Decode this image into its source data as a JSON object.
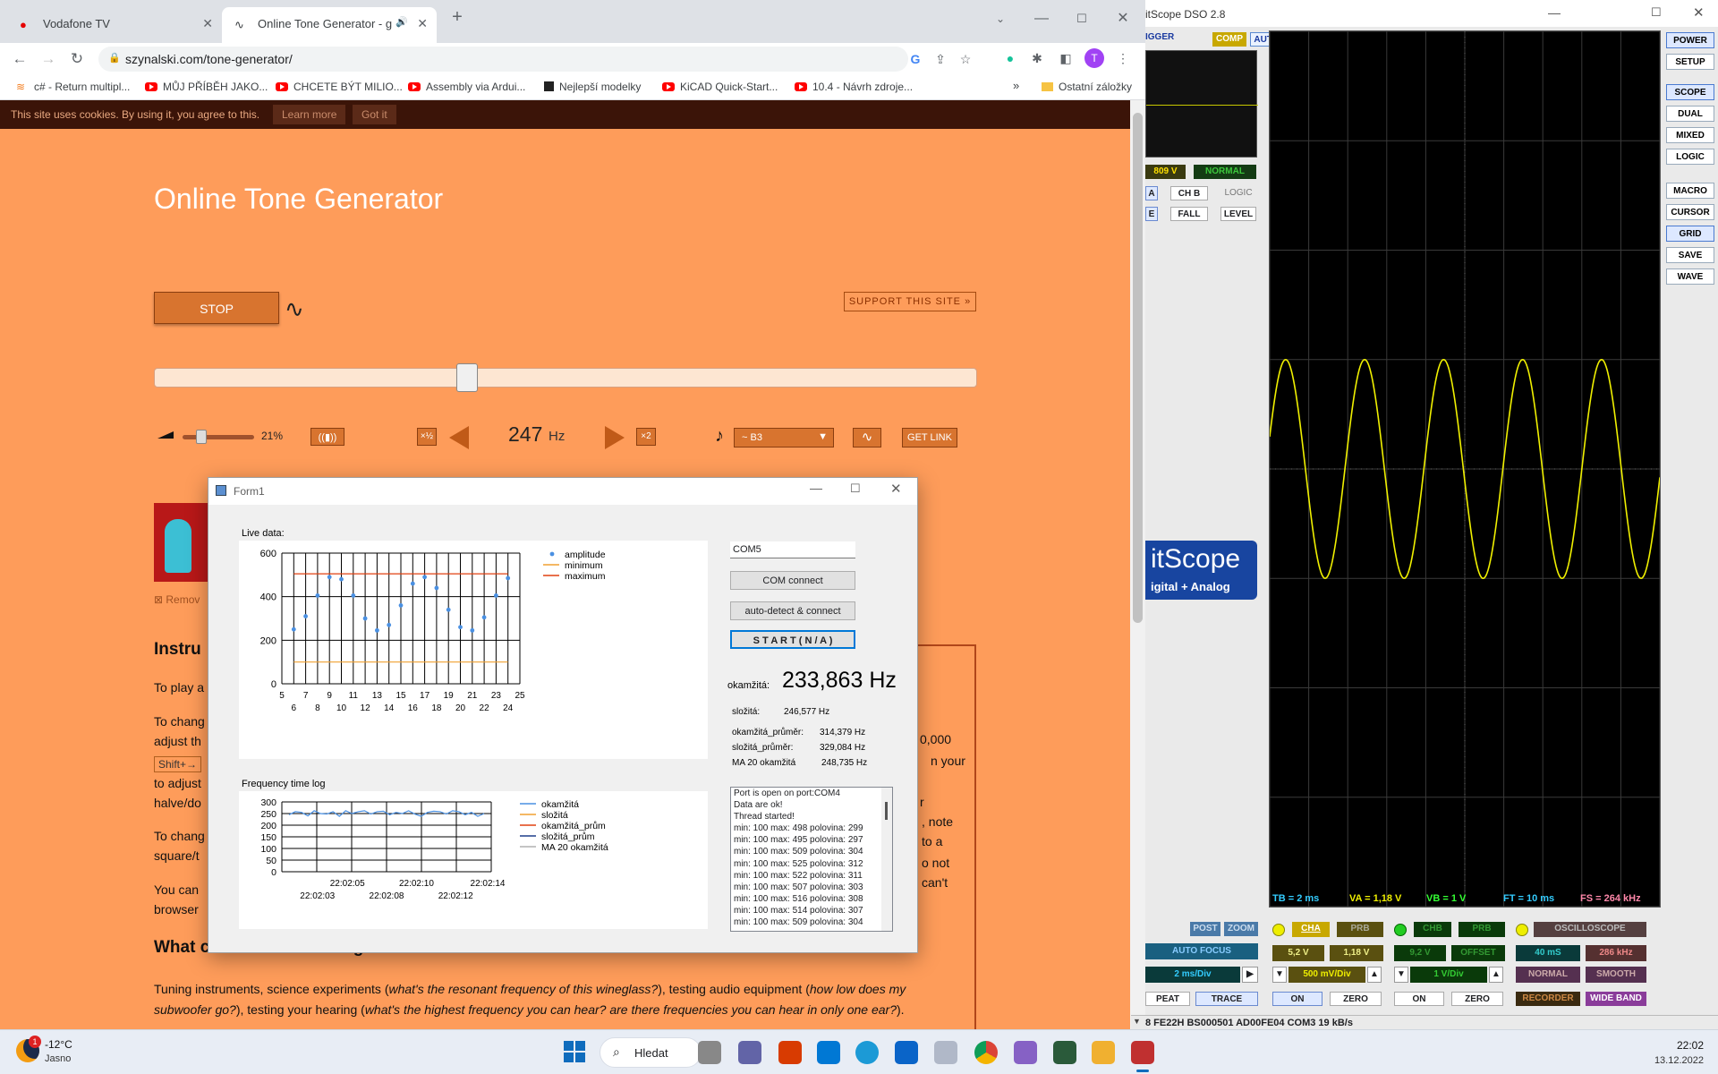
{
  "browser": {
    "tabs": [
      {
        "title": "Vodafone TV"
      },
      {
        "title": "Online Tone Generator - gen"
      }
    ],
    "url": "szynalski.com/tone-generator/",
    "profile_initial": "T",
    "bookmarks": [
      "c# - Return multipl...",
      "MŮJ PŘÍBĚH JAKO...",
      "CHCETE BÝT MILIO...",
      "Assembly via Ardui...",
      "Nejlepší modelky",
      "KiCAD Quick-Start...",
      "10.4 - Návrh zdroje..."
    ],
    "other_bookmarks": "Ostatní záložky"
  },
  "page": {
    "cookie_text": "This site uses cookies. By using it, you agree to this.",
    "learn_more": "Learn more",
    "got_it": "Got it",
    "title": "Online Tone Generator",
    "stop": "STOP",
    "support": "SUPPORT THIS SITE »",
    "frequency_slider_level": 0.38,
    "volume_pct": "21%",
    "volume_level": 0.21,
    "half": "×½",
    "double": "×2",
    "freq_value": "247",
    "freq_unit": "Hz",
    "note": "~ B3",
    "get_link": "GET LINK",
    "remove": "Remov",
    "instr_heading": "Instru",
    "para1": "To play a",
    "para2a": "To chang",
    "para2b": "adjust th",
    "shift": "Shift+→",
    "para2c": "to adjust",
    "para2d": "halve/do",
    "para3a": "To chang",
    "para3b": "square/t",
    "para4a": "You can",
    "para4b": "browser",
    "right_frag": [
      "0,000",
      "n your",
      "r",
      ", note",
      "to a",
      "o not",
      "can't"
    ],
    "what_heading": "What can I use this tone generator for?",
    "body_1": "Tuning instruments, science experiments (",
    "body_1i": "what's the resonant frequency of this wineglass?",
    "body_2": "), testing audio equipment (",
    "body_2i": "how low does my",
    "body_3i": "subwoofer go?",
    "body_4": "), testing your hearing (",
    "body_4i": "what's the highest frequency you can hear? are there frequencies you can hear in only one ear?",
    "body_5": ")."
  },
  "form1": {
    "title": "Form1",
    "live_label": "Live data:",
    "freq_log_label": "Frequency time log",
    "com_value": "COM5",
    "com_connect": "COM connect",
    "auto_detect": "auto-detect & connect",
    "start": "S T A R T ( N / A )",
    "okamzita_label": "okamžitá:",
    "okamzita_value": "233,863 Hz",
    "slozita_label": "složitá:",
    "slozita_value": "246,577 Hz",
    "okamzita_prumer_label": "okamžitá_průměr:",
    "okamzita_prumer_value": "314,379 Hz",
    "slozita_prumer_label": "složitá_průměr:",
    "slozita_prumer_value": "329,084 Hz",
    "ma20_label": "MA 20 okamžitá",
    "ma20_value": "248,735 Hz",
    "log_lines": [
      "Port is open on port:COM4",
      "Data are ok!",
      "Thread started!",
      "min: 100 max: 498 polovina: 299",
      "min: 100 max: 495 polovina: 297",
      "min: 100 max: 509 polovina: 304",
      "min: 100 max: 525 polovina: 312",
      "min: 100 max: 522 polovina: 311",
      "min: 100 max: 507 polovina: 303",
      "min: 100 max: 516 polovina: 308",
      "min: 100 max: 514 polovina: 307",
      "min: 100 max: 509 polovina: 304"
    ]
  },
  "chart_data": [
    {
      "type": "scatter",
      "title": "Live data:",
      "x": [
        6,
        7,
        8,
        9,
        10,
        11,
        12,
        13,
        14,
        15,
        16,
        17,
        18,
        19,
        20,
        21,
        22,
        23,
        24
      ],
      "series": [
        {
          "name": "amplitude",
          "values": [
            250,
            310,
            405,
            490,
            480,
            405,
            300,
            245,
            270,
            360,
            460,
            490,
            440,
            340,
            260,
            245,
            305,
            405,
            485
          ]
        },
        {
          "name": "minimum",
          "values": [
            100,
            100,
            100,
            100,
            100,
            100,
            100,
            100,
            100,
            100,
            100,
            100,
            100,
            100,
            100,
            100,
            100,
            100,
            100
          ]
        },
        {
          "name": "maximum",
          "values": [
            505,
            505,
            505,
            505,
            505,
            505,
            505,
            505,
            505,
            505,
            505,
            505,
            505,
            505,
            505,
            505,
            505,
            505,
            505
          ]
        }
      ],
      "xlim": [
        5,
        25
      ],
      "ylim": [
        0,
        600
      ],
      "yticks": [
        0,
        200,
        400,
        600
      ],
      "xticks_top": [
        "5",
        "7",
        "9",
        "11",
        "13",
        "15",
        "17",
        "19",
        "21",
        "23",
        "25"
      ],
      "xticks_bottom": [
        "6",
        "8",
        "10",
        "12",
        "14",
        "16",
        "18",
        "20",
        "22",
        "24"
      ],
      "colors": {
        "amplitude": "#4a90e2",
        "minimum": "#f0a030",
        "maximum": "#e04010"
      },
      "legend": "top-right",
      "grid": true
    },
    {
      "type": "line",
      "title": "Frequency time log",
      "series": [
        {
          "name": "okamžitá",
          "values": [
            245,
            258,
            255,
            240,
            262,
            250,
            248,
            258,
            238,
            262,
            250,
            258,
            262,
            248,
            258,
            260,
            245,
            255,
            250,
            262,
            248,
            238,
            255,
            260,
            258,
            248,
            262,
            258,
            245,
            255,
            238,
            250
          ]
        },
        {
          "name": "složitá",
          "values": [
            250,
            250,
            250,
            250,
            250,
            250,
            250,
            250,
            250,
            250,
            250,
            250,
            250,
            250,
            250,
            250,
            250,
            250,
            250,
            250,
            250,
            250,
            250,
            250,
            250,
            250,
            250,
            250,
            250,
            250,
            250,
            250
          ]
        },
        {
          "name": "okamžitá_prům",
          "values": []
        },
        {
          "name": "složitá_prům",
          "values": []
        },
        {
          "name": "MA 20 okamžitá",
          "values": []
        }
      ],
      "ylim": [
        0,
        300
      ],
      "yticks": [
        0,
        50,
        100,
        150,
        200,
        250,
        300
      ],
      "xticks_top": [
        "22:02:05",
        "22:02:10",
        "22:02:14"
      ],
      "xticks_bottom": [
        "22:02:03",
        "22:02:08",
        "22:02:12"
      ],
      "colors": {
        "okamžitá": "#4a90e2",
        "složitá": "#f0a030",
        "okamžitá_prům": "#e04010",
        "složitá_prům": "#1f3f8a",
        "MA 20 okamžitá": "#b0b0b0"
      },
      "legend": "top-right",
      "grid": true
    }
  ],
  "bitscope": {
    "title": "itScope DSO 2.8",
    "trigger": "IGGER",
    "comp": "COMP",
    "auto": "AUTO",
    "trig_voltage": "809 V",
    "normal": "NORMAL",
    "a": "A",
    "chb": "CH B",
    "logic": "LOGIC",
    "e": "E",
    "fall": "FALL",
    "level": "LEVEL",
    "logo": "itScope",
    "logo_sub": "igital + Analog",
    "side_buttons": [
      "POWER",
      "SETUP",
      "SCOPE",
      "DUAL",
      "MIXED",
      "LOGIC",
      "MACRO",
      "CURSOR",
      "GRID",
      "SAVE",
      "WAVE"
    ],
    "status": {
      "tb": "TB = 2 ms",
      "va": "VA = 1,18 V",
      "vb": "VB = 1 V",
      "ft": "FT = 10 ms",
      "fs": "FS = 264 kHz"
    },
    "post": "POST",
    "zoom": "ZOOM",
    "auto_focus": "AUTO FOCUS",
    "time_div": "2 ms/Div",
    "peat": "PEAT",
    "trace": "TRACE",
    "cha": "CHA",
    "prb_a": "PRB",
    "cha_v1": "5,2 V",
    "cha_v2": "1,18 V",
    "cha_div": "500 mV/Div",
    "on_a": "ON",
    "zero_a": "ZERO",
    "chb2": "CHB",
    "prb_b": "PRB",
    "chb_v1": "9,2 V",
    "chb_offset": "OFFSET",
    "chb_div": "1 V/Div",
    "on_b": "ON",
    "zero_b": "ZERO",
    "osc": "OSCILLOSCOPE",
    "ms40": "40 mS",
    "khz": "286 kHz",
    "normal2": "NORMAL",
    "smooth": "SMOOTH",
    "recorder": "RECORDER",
    "wideband": "WIDE BAND",
    "statusbar": "8 FE22H BS000501 AD00FE04 COM3 19 kB/s",
    "signal": {
      "frequency_hz": 247,
      "amplitude_div": 1.0
    }
  },
  "taskbar": {
    "weather_temp": "-12°C",
    "weather_text": "Jasno",
    "weather_badge": "1",
    "search": "Hledat",
    "time": "22:02",
    "date": "13.12.2022"
  }
}
